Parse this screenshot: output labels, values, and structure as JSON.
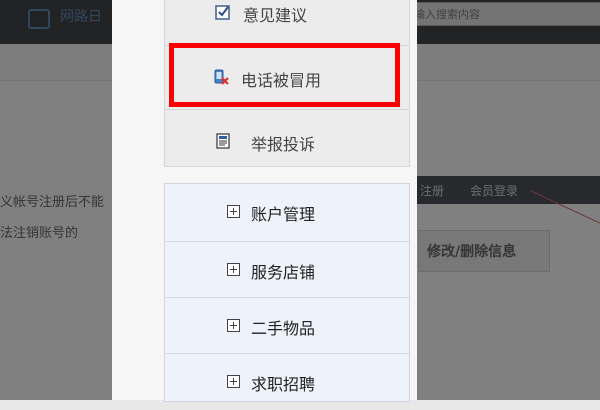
{
  "background": {
    "site_name": "网路日",
    "search_placeholder": "输入搜索内容",
    "text_line_1": "义帐号注册后不能",
    "text_line_2": "法注销账号的",
    "nav_register": "注册",
    "nav_login": "会员登录",
    "button": "修改/删除信息"
  },
  "modal": {
    "options": [
      {
        "label": "意见建议",
        "icon": "checkbox-icon"
      },
      {
        "label": "电话被冒用",
        "icon": "phone-blocked-icon",
        "highlighted": true
      },
      {
        "label": "举报投诉",
        "icon": "report-document-icon"
      }
    ],
    "menu": [
      {
        "label": "账户管理"
      },
      {
        "label": "服务店铺"
      },
      {
        "label": "二手物品"
      },
      {
        "label": "求职招聘"
      }
    ]
  },
  "colors": {
    "highlight": "#ff0000",
    "overlay": "#000000"
  }
}
